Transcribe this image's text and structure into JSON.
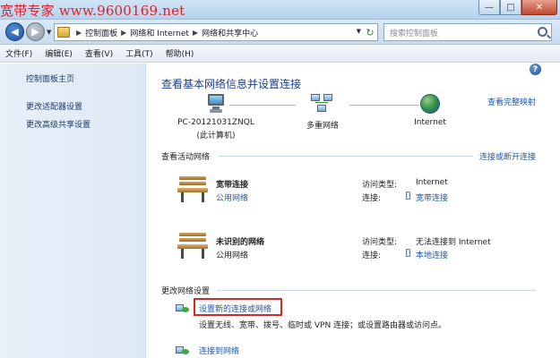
{
  "watermark": "宽带专家 www.9600169.net",
  "window_controls": {
    "minimize": "—",
    "maximize": "□",
    "close": "✕"
  },
  "address": {
    "crumbs": [
      "控制面板",
      "网络和 Internet",
      "网络和共享中心"
    ],
    "refresh_glyph": "↻",
    "dropdown_glyph": "▼"
  },
  "search": {
    "placeholder": "搜索控制面板"
  },
  "menu": [
    "文件(F)",
    "编辑(E)",
    "查看(V)",
    "工具(T)",
    "帮助(H)"
  ],
  "sidebar": {
    "items": [
      "控制面板主页",
      "更改适配器设置",
      "更改高级共享设置"
    ]
  },
  "main": {
    "help_glyph": "?",
    "title": "查看基本网络信息并设置连接",
    "full_map_link": "查看完整映射",
    "map_nodes": [
      {
        "label": "PC-20121031ZNQL",
        "sublabel": "(此计算机)",
        "icon": "computer-icon"
      },
      {
        "label": "多重网络",
        "icon": "multiple-networks-icon"
      },
      {
        "label": "Internet",
        "icon": "globe-icon"
      }
    ],
    "active_section_label": "查看活动网络",
    "connect_link": "连接或断开连接",
    "networks": [
      {
        "name": "宽带连接",
        "type": "公用网络",
        "type_is_link": true,
        "access_key": "访问类型:",
        "access_value": "Internet",
        "conn_key": "连接:",
        "conn_value": "宽带连接"
      },
      {
        "name": "未识别的网络",
        "type": "公用网络",
        "type_is_link": false,
        "access_key": "访问类型:",
        "access_value": "无法连接到 Internet",
        "conn_key": "连接:",
        "conn_value": "本地连接"
      }
    ],
    "change_section_label": "更改网络设置",
    "tasks": [
      {
        "link": "设置新的连接或网络",
        "desc": "设置无线、宽带、拨号、临时或 VPN 连接；或设置路由器或访问点。",
        "highlighted": true
      },
      {
        "link": "连接到网络",
        "desc": ""
      }
    ],
    "colors": {
      "link": "#2257a8",
      "title": "#1c3d8a",
      "highlight": "#d22a2a"
    }
  }
}
